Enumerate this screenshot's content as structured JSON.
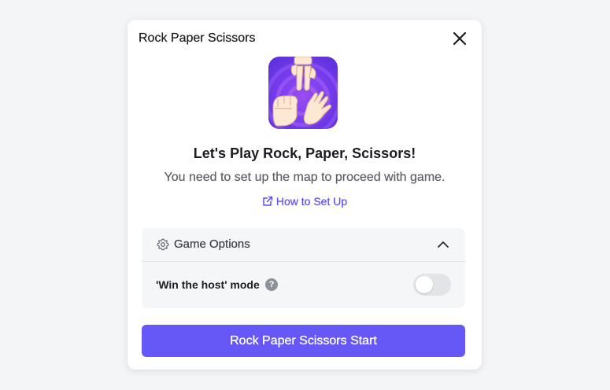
{
  "dialog": {
    "title": "Rock Paper Scissors",
    "close_icon": "close-icon"
  },
  "game": {
    "icon": "rock-paper-scissors-icon",
    "headline": "Let's Play Rock, Paper, Scissors!",
    "subtext": "You need to set up the map to proceed with game.",
    "howto_label": "How to Set Up",
    "howto_icon": "external-link-icon"
  },
  "options": {
    "title": "Game Options",
    "icon": "gear-icon",
    "expanded": true,
    "win_host_label": "'Win the host' mode",
    "help_glyph": "?",
    "win_host_enabled": false
  },
  "start_button": {
    "label": "Rock Paper Scissors Start"
  },
  "colors": {
    "accent": "#6657f7",
    "link": "#5b4ff5",
    "background": "#f4f5f7"
  }
}
